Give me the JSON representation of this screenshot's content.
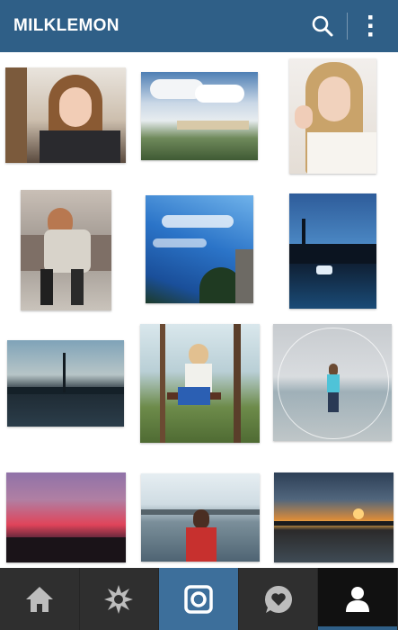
{
  "header": {
    "title": "MILKLEMON",
    "accent_color": "#2f5f87",
    "search_icon": "search-icon",
    "overflow_icon": "more-vertical-icon"
  },
  "photos": [
    {
      "name": "photo-girl-selfie-window"
    },
    {
      "name": "photo-clouds-landscape"
    },
    {
      "name": "photo-blonde-selfie"
    },
    {
      "name": "photo-girl-sitting-bench"
    },
    {
      "name": "photo-blue-sky-trees"
    },
    {
      "name": "photo-night-harbor"
    },
    {
      "name": "photo-river-dusk-bridge"
    },
    {
      "name": "photo-girl-on-swing"
    },
    {
      "name": "photo-girl-on-beach"
    },
    {
      "name": "photo-purple-sunset-city"
    },
    {
      "name": "photo-girl-by-lake"
    },
    {
      "name": "photo-lake-sunset"
    }
  ],
  "tabs": [
    {
      "name": "home-tab",
      "icon": "home-icon"
    },
    {
      "name": "explore-tab",
      "icon": "explore-icon"
    },
    {
      "name": "camera-tab",
      "icon": "camera-icon"
    },
    {
      "name": "activity-tab",
      "icon": "heart-bubble-icon"
    },
    {
      "name": "profile-tab",
      "icon": "profile-icon"
    }
  ],
  "colors": {
    "tab_bg": "#2f2f2f",
    "camera_tab_bg": "#3d6f9b",
    "profile_tab_bg": "#111111"
  }
}
